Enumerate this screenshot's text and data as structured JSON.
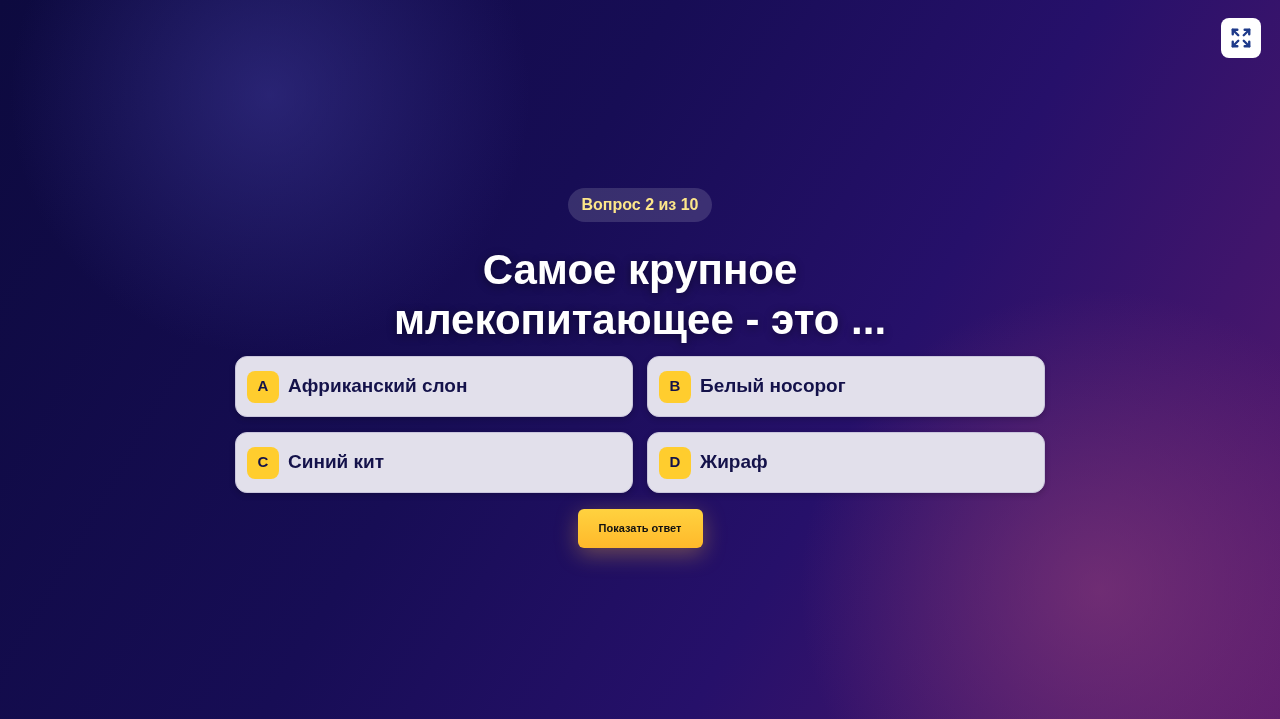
{
  "progress": "Вопрос 2 из 10",
  "question": "Самое крупное млекопитающее - это ...",
  "answers": [
    {
      "letter": "A",
      "text": "Африканский слон"
    },
    {
      "letter": "B",
      "text": "Белый носорог"
    },
    {
      "letter": "C",
      "text": "Синий кит"
    },
    {
      "letter": "D",
      "text": "Жираф"
    }
  ],
  "reveal_button": "Показать ответ"
}
